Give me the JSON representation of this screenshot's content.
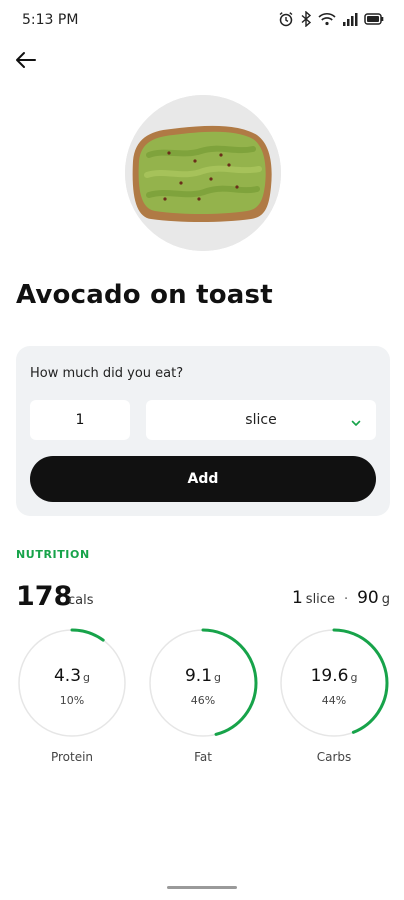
{
  "status_bar": {
    "time": "5:13 PM",
    "icons": [
      "alarm-icon",
      "bluetooth-icon",
      "wifi-icon",
      "signal-icon",
      "battery-icon"
    ]
  },
  "nav": {
    "back_icon": "arrow-left-icon"
  },
  "food": {
    "title": "Avocado on toast",
    "image": "avocado-toast-photo"
  },
  "portion": {
    "question": "How much did you eat?",
    "quantity": "1",
    "unit": "slice",
    "add_label": "Add"
  },
  "nutrition": {
    "header": "NUTRITION",
    "calories": "178",
    "calories_unit": "cals",
    "serving_qty": "1",
    "serving_unit": "slice",
    "serving_separator": "·",
    "serving_weight": "90",
    "serving_weight_unit": "g",
    "accent_color": "#17a34a",
    "macros": [
      {
        "name": "Protein",
        "value": "4.3",
        "unit": "g",
        "percent_label": "10%",
        "fraction": 0.1
      },
      {
        "name": "Fat",
        "value": "9.1",
        "unit": "g",
        "percent_label": "46%",
        "fraction": 0.46
      },
      {
        "name": "Carbs",
        "value": "19.6",
        "unit": "g",
        "percent_label": "44%",
        "fraction": 0.44
      }
    ]
  }
}
